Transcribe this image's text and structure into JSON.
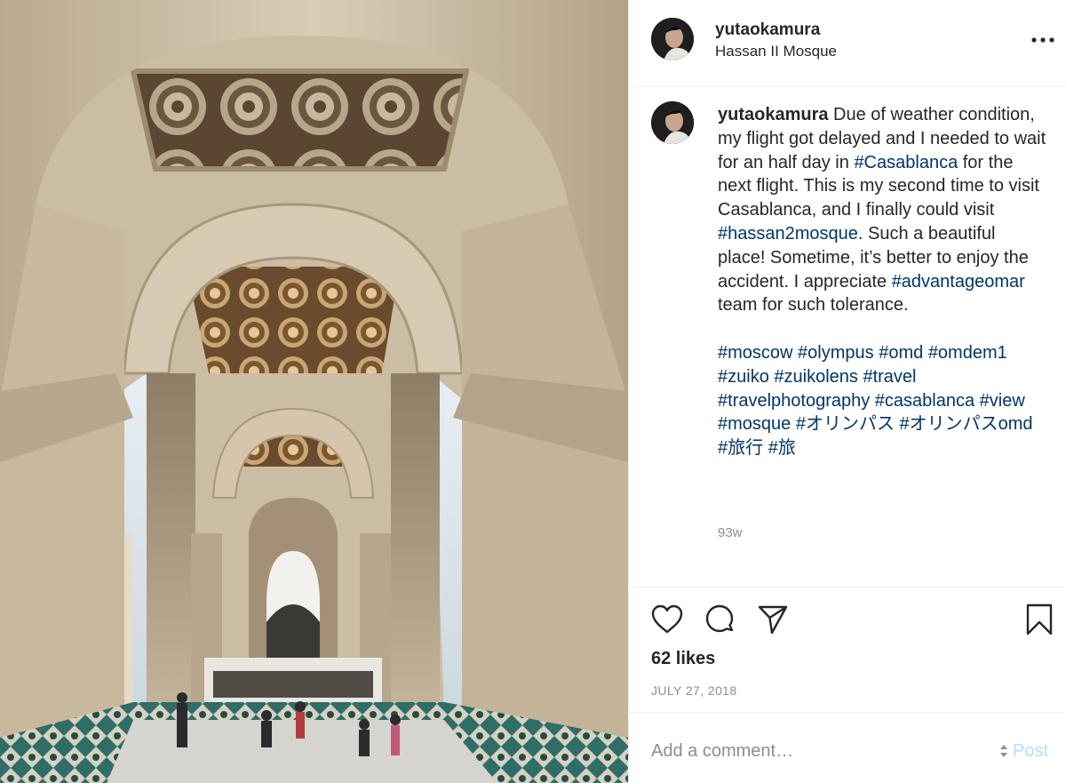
{
  "post": {
    "username": "yutaokamura",
    "location": "Hassan II Mosque",
    "caption": {
      "user": "yutaokamura",
      "line1_a": " Due of weather condition, my flight got delayed and I needed to wait for an half day in ",
      "tag_casablanca": "#Casablanca",
      "line1_b": " for the next flight. This is my second time to visit Casablanca, and I finally could visit ",
      "tag_hassan": "#hassan2mosque",
      "line1_c": ". Such a beautiful place! Sometime, it’s better to enjoy the accident. I appreciate ",
      "tag_advantage": "#advantageomar",
      "line1_d": " team for such tolerance.",
      "hashtags": [
        "#moscow",
        "#olympus",
        "#omd",
        "#omdem1",
        "#zuiko",
        "#zuikolens",
        "#travel",
        "#travelphotography",
        "#casablanca",
        "#view",
        "#mosque",
        "#オリンパス",
        "#オリンパスomd",
        "#旅行",
        "#旅"
      ]
    },
    "time_ago": "93w",
    "likes": "62 likes",
    "date": "JULY 27, 2018"
  },
  "comment": {
    "placeholder": "Add a comment…",
    "post_label": "Post"
  },
  "icons": {
    "more": "more-options-icon",
    "like": "heart-icon",
    "comment": "comment-bubble-icon",
    "share": "paper-plane-icon",
    "save": "bookmark-icon"
  },
  "colors": {
    "hashtag": "#003569",
    "muted": "#8e8e8e",
    "post_disabled": "#b2dffc",
    "text": "#262626"
  }
}
